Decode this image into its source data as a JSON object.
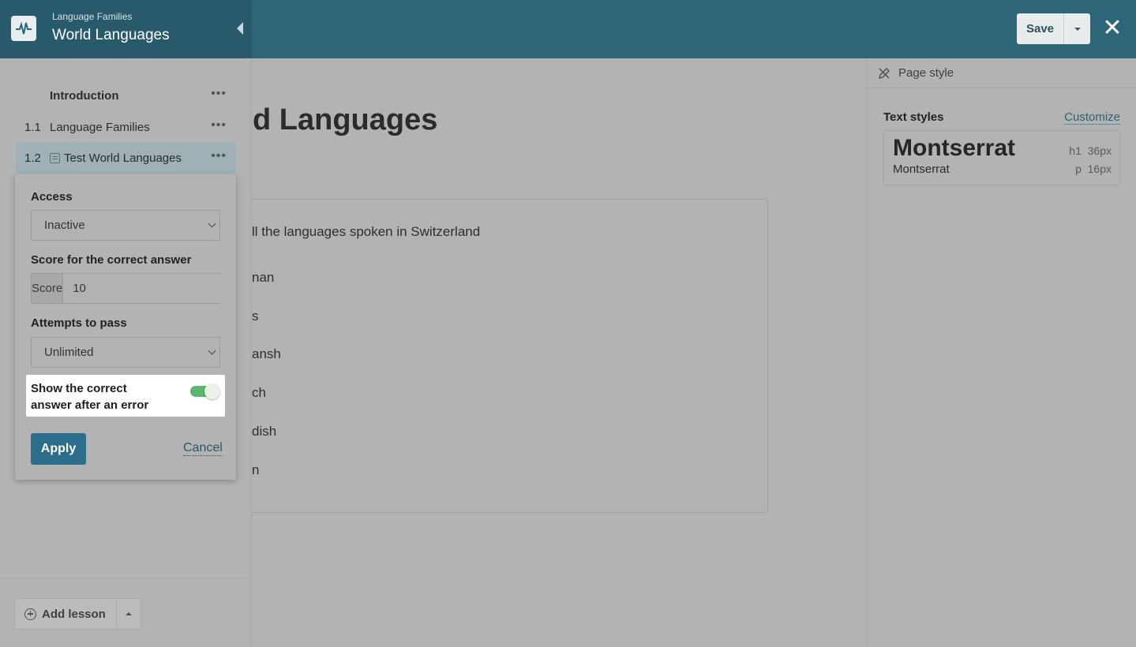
{
  "header": {
    "breadcrumb": "Language Families",
    "course_title": "World Languages",
    "save_label": "Save"
  },
  "toc": [
    {
      "num": "",
      "label": "Introduction",
      "bold": true
    },
    {
      "num": "1.1",
      "label": "Language Families"
    },
    {
      "num": "1.2",
      "label": "Test World Languages",
      "selected": true
    }
  ],
  "popover": {
    "access_label": "Access",
    "access_value": "Inactive",
    "score_label": "Score for the correct answer",
    "score_prefix": "Score",
    "score_value": "10",
    "attempts_label": "Attempts to pass",
    "attempts_value": "Unlimited",
    "show_answer_label": "Show the correct answer after an error",
    "show_answer_enabled": true,
    "apply_label": "Apply",
    "cancel_label": "Cancel"
  },
  "main": {
    "title": "d Languages",
    "question": "ll the languages spoken in Switzerland",
    "answers": [
      "nan",
      "s",
      "ansh",
      "ch",
      "dish",
      "n"
    ]
  },
  "sidebar_footer": {
    "add_lesson_label": "Add lesson"
  },
  "right_panel": {
    "tab_label": "Page style",
    "text_styles_label": "Text styles",
    "customize_label": "Customize",
    "heading_font": "Montserrat",
    "body_font": "Montserrat",
    "h1_tag": "h1",
    "h1_size": "36px",
    "p_tag": "p",
    "p_size": "16px"
  },
  "colors": {
    "header_bg": "#2d6679",
    "apply_button": "#2c6e8a",
    "toggle_on": "#5bb56c"
  }
}
